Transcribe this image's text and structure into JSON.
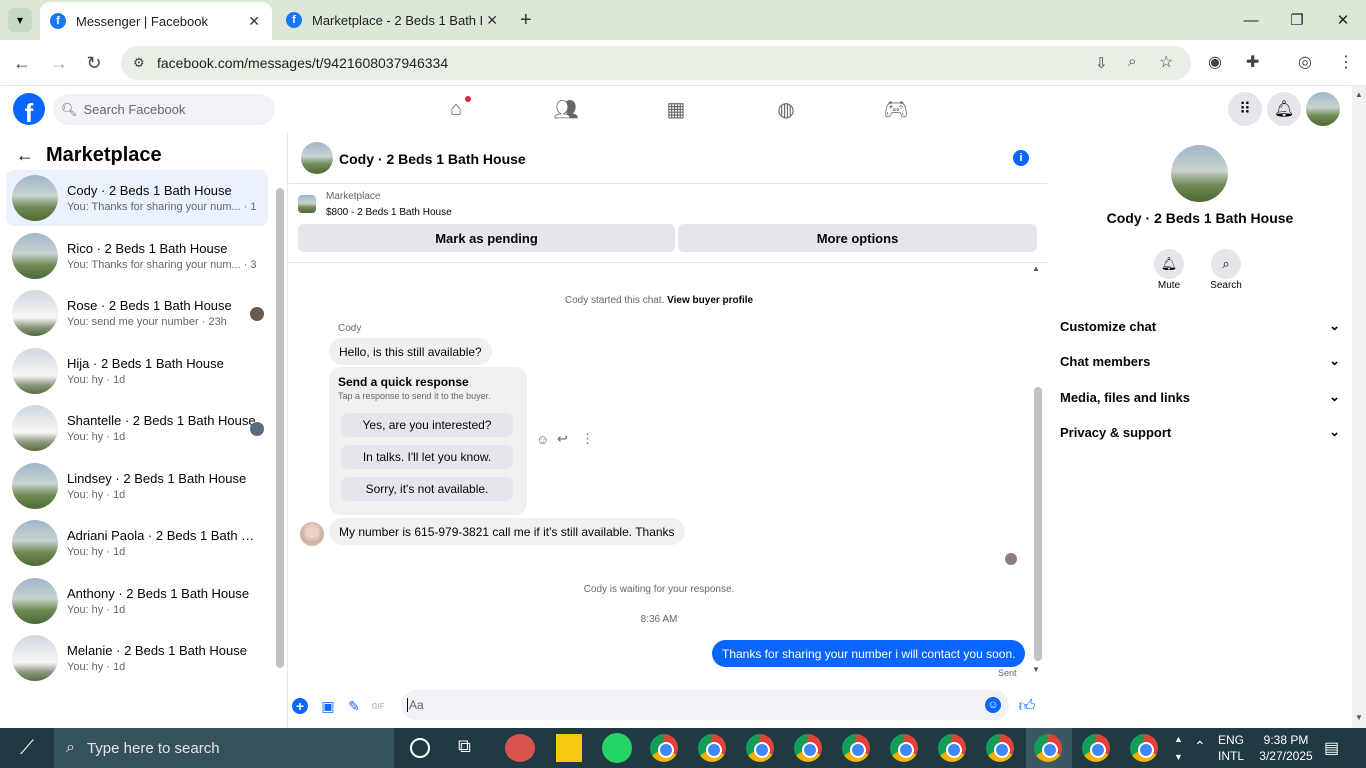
{
  "browser": {
    "tabs": [
      {
        "title": "Messenger | Facebook",
        "active": true
      },
      {
        "title": "Marketplace - 2 Beds 1 Bath Ho",
        "active": false
      }
    ],
    "url": "facebook.com/messages/t/9421608037946334"
  },
  "fb": {
    "search_placeholder": "Search Facebook"
  },
  "sidebar": {
    "title": "Marketplace",
    "conversations": [
      {
        "title": "Cody · 2 Beds 1 Bath House",
        "snippet": "You: Thanks for sharing your num... · 1m",
        "active": true
      },
      {
        "title": "Rico · 2 Beds 1 Bath House",
        "snippet": "You: Thanks for sharing your num... · 3m"
      },
      {
        "title": "Rose · 2 Beds 1 Bath House",
        "snippet": "You: send me your number · 23h"
      },
      {
        "title": "Hija · 2 Beds 1 Bath House",
        "snippet": "You: hy · 1d"
      },
      {
        "title": "Shantelle · 2 Beds 1 Bath House",
        "snippet": "You: hy · 1d"
      },
      {
        "title": "Lindsey · 2 Beds 1 Bath House",
        "snippet": "You: hy · 1d"
      },
      {
        "title": "Adriani Paola · 2 Beds 1 Bath Ho...",
        "snippet": "You: hy · 1d"
      },
      {
        "title": "Anthony · 2 Beds 1 Bath House",
        "snippet": "You: hy · 1d"
      },
      {
        "title": "Melanie · 2 Beds 1 Bath House",
        "snippet": "You: hy · 1d"
      }
    ]
  },
  "chat": {
    "title": "Cody · 2 Beds 1 Bath House",
    "listing_source": "Marketplace",
    "listing_price": "$800 - 2 Beds 1 Bath House",
    "mark_pending": "Mark as pending",
    "more_options": "More options",
    "started_text": "Cody started this chat.",
    "view_profile": "View buyer profile",
    "sender_name": "Cody",
    "msg1": "Hello, is this still available?",
    "quick_title": "Send a quick response",
    "quick_sub": "Tap a response to send it to the buyer.",
    "quick_options": [
      "Yes, are you interested?",
      "In talks. I'll let you know.",
      "Sorry, it's not available."
    ],
    "msg2": "My number is 615-979-3821 call me if  it's still available. Thanks",
    "waiting": "Cody is waiting for your response.",
    "time": "8:36 AM",
    "my_msg": "Thanks for sharing your number i will contact you soon.",
    "sent": "Sent",
    "input_placeholder": "Aa"
  },
  "rightpanel": {
    "name": "Cody · 2 Beds 1 Bath House",
    "mute": "Mute",
    "search": "Search",
    "rows": [
      "Customize chat",
      "Chat members",
      "Media, files and links",
      "Privacy & support"
    ]
  },
  "taskbar": {
    "search_placeholder": "Type here to search",
    "lang1": "ENG",
    "lang2": "INTL",
    "time": "9:38 PM",
    "date": "3/27/2025"
  },
  "colors": {
    "fb_blue": "#0866ff",
    "active_conv": "#ebf2fd"
  }
}
